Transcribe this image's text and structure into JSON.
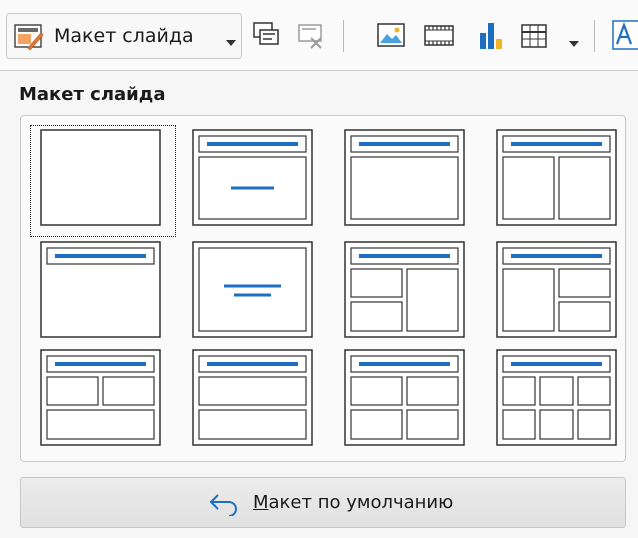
{
  "toolbar": {
    "layout_dropdown_label": "Макет слайда",
    "icons": [
      "slide-layout-icon",
      "chevron-down-icon",
      "duplicate-slide-icon",
      "delete-slide-icon",
      "image-icon",
      "media-icon",
      "chart-icon",
      "table-icon",
      "chevron-down-icon",
      "text-box-icon"
    ]
  },
  "panel": {
    "title": "Макет слайда",
    "layouts": [
      {
        "id": "blank",
        "selected": true
      },
      {
        "id": "title-content"
      },
      {
        "id": "title-only"
      },
      {
        "id": "title-two-columns"
      },
      {
        "id": "title-top"
      },
      {
        "id": "centered-text"
      },
      {
        "id": "title-content-left-two"
      },
      {
        "id": "title-content-right-two"
      },
      {
        "id": "title-two-top-one-bottom"
      },
      {
        "id": "title-content-over-content"
      },
      {
        "id": "title-2x2"
      },
      {
        "id": "title-6-content"
      }
    ],
    "default_button_label": "Макет по умолчанию"
  },
  "colors": {
    "accent_blue": "#1e6fc2",
    "frame_stroke": "#333333",
    "icon_orange": "#e8803a"
  }
}
